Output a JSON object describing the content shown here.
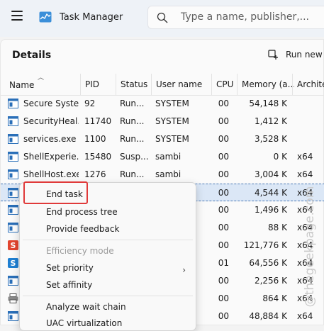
{
  "window": {
    "title": "Task Manager",
    "search_placeholder": "Type a name, publisher,...",
    "hamburger_icon": "menu-icon",
    "app_icon": "task-manager-icon"
  },
  "page": {
    "section_title": "Details",
    "run_task_label": "Run new t"
  },
  "table": {
    "columns": [
      "Name",
      "PID",
      "Status",
      "User name",
      "CPU",
      "Memory (a...",
      "Archite"
    ],
    "sort_column": "Name",
    "rows": [
      {
        "name": "Secure System",
        "pid": "92",
        "status": "Run...",
        "user": "SYSTEM",
        "cpu": "00",
        "mem": "54,148 K",
        "arch": "",
        "icon": "process-window-icon"
      },
      {
        "name": "SecurityHeal...",
        "pid": "11740",
        "status": "Run...",
        "user": "SYSTEM",
        "cpu": "00",
        "mem": "1,412 K",
        "arch": "",
        "icon": "process-window-icon"
      },
      {
        "name": "services.exe",
        "pid": "1100",
        "status": "Run...",
        "user": "SYSTEM",
        "cpu": "00",
        "mem": "3,528 K",
        "arch": "",
        "icon": "process-window-icon"
      },
      {
        "name": "ShellExperie...",
        "pid": "15480",
        "status": "Susp...",
        "user": "sambi",
        "cpu": "00",
        "mem": "0 K",
        "arch": "x64",
        "icon": "process-window-icon"
      },
      {
        "name": "ShellHost.exe",
        "pid": "1276",
        "status": "Run...",
        "user": "sambi",
        "cpu": "00",
        "mem": "3,004 K",
        "arch": "x64",
        "icon": "process-window-icon"
      },
      {
        "name": "",
        "pid": "",
        "status": "",
        "user": "",
        "cpu": "00",
        "mem": "4,544 K",
        "arch": "x64",
        "icon": "process-window-icon",
        "selected": true
      },
      {
        "name": "",
        "pid": "",
        "status": "",
        "user": "",
        "cpu": "00",
        "mem": "1,496 K",
        "arch": "x64",
        "icon": "process-window-icon"
      },
      {
        "name": "",
        "pid": "",
        "status": "",
        "user": "",
        "cpu": "00",
        "mem": "88 K",
        "arch": "x64",
        "icon": "process-window-icon"
      },
      {
        "name": "",
        "pid": "",
        "status": "",
        "user": "",
        "cpu": "00",
        "mem": "121,776 K",
        "arch": "x64",
        "icon": "snagit-icon"
      },
      {
        "name": "",
        "pid": "",
        "status": "",
        "user": "",
        "cpu": "01",
        "mem": "64,556 K",
        "arch": "x64",
        "icon": "snagit-editor-icon"
      },
      {
        "name": "",
        "pid": "",
        "status": "",
        "user": "",
        "cpu": "00",
        "mem": "2,256 K",
        "arch": "x64",
        "icon": "process-window-icon"
      },
      {
        "name": "",
        "pid": "",
        "status": "",
        "user": "",
        "cpu": "00",
        "mem": "864 K",
        "arch": "x64",
        "icon": "printer-icon"
      },
      {
        "name": "",
        "pid": "",
        "status": "",
        "user": "",
        "cpu": "00",
        "mem": "48,884 K",
        "arch": "x64",
        "icon": "process-window-icon"
      }
    ]
  },
  "context_menu": {
    "items": [
      {
        "label": "End task",
        "enabled": true
      },
      {
        "label": "End process tree",
        "enabled": true
      },
      {
        "label": "Provide feedback",
        "enabled": true
      },
      {
        "label": "Efficiency mode",
        "enabled": false
      },
      {
        "label": "Set priority",
        "enabled": true,
        "submenu": true
      },
      {
        "label": "Set affinity",
        "enabled": true
      },
      {
        "label": "Analyze wait chain",
        "enabled": true
      },
      {
        "label": "UAC virtualization",
        "enabled": true
      }
    ]
  },
  "watermark": "@thegeekpage.com",
  "colors": {
    "accent": "#0067c0",
    "selection": "#dbe7f6",
    "highlight_box": "#e03a3a"
  }
}
